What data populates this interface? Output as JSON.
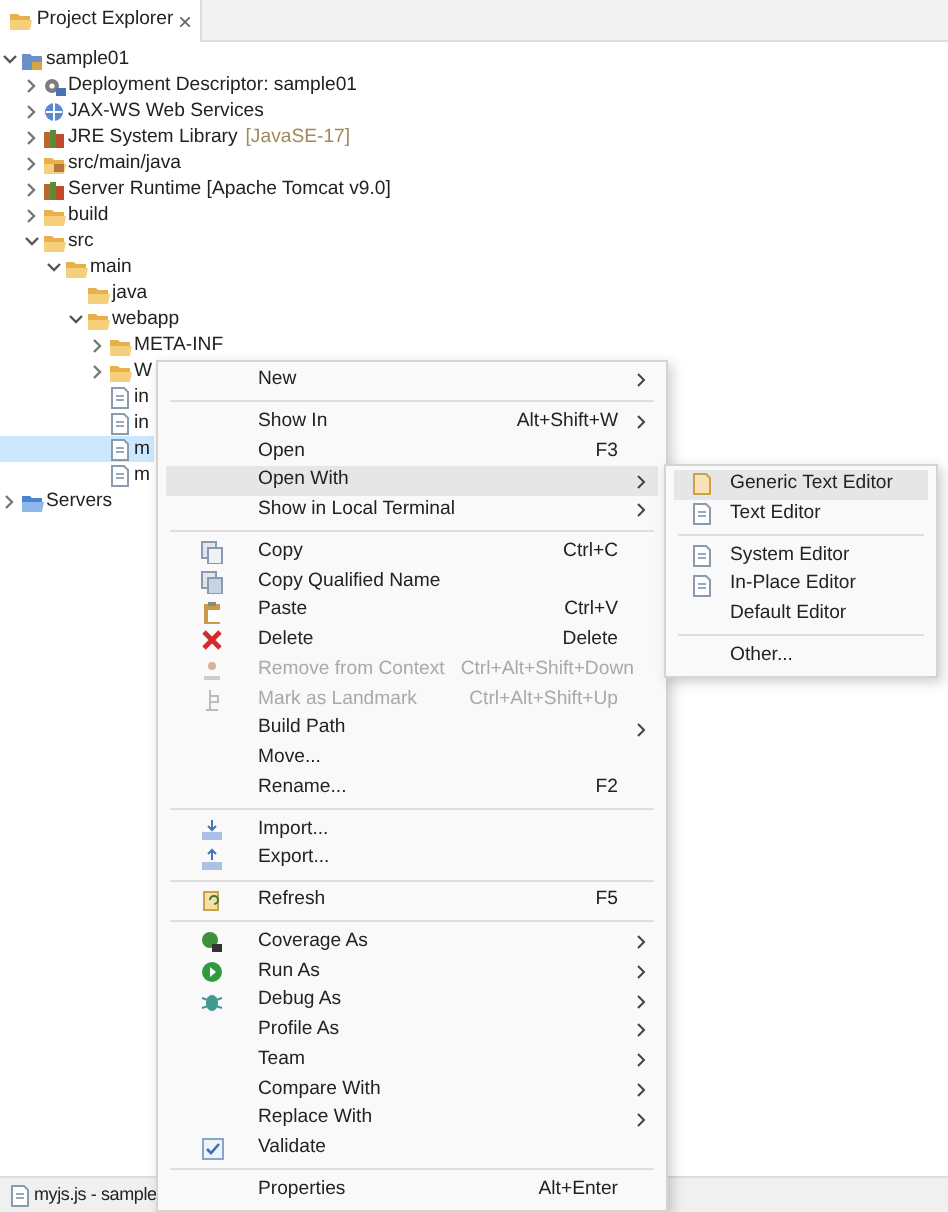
{
  "view_tab": {
    "title": "Project Explorer",
    "close": "×"
  },
  "tree": [
    {
      "label": "sample01",
      "kind": "project",
      "expanded": true,
      "selected": false,
      "children": [
        {
          "label": "Deployment Descriptor: sample01",
          "kind": "deployment",
          "expanded": false,
          "selected": false
        },
        {
          "label": "JAX-WS Web Services",
          "kind": "webservices",
          "expanded": false,
          "selected": false
        },
        {
          "label": "JRE System Library",
          "decoration": "[JavaSE-17]",
          "kind": "library",
          "expanded": false,
          "selected": false
        },
        {
          "label": "src/main/java",
          "kind": "source-folder",
          "expanded": false,
          "selected": false
        },
        {
          "label": "Server Runtime [Apache Tomcat v9.0]",
          "kind": "library",
          "expanded": false,
          "selected": false
        },
        {
          "label": "build",
          "kind": "folder",
          "expanded": false,
          "selected": false
        },
        {
          "label": "src",
          "kind": "folder",
          "expanded": true,
          "selected": false,
          "children": [
            {
              "label": "main",
              "kind": "folder",
              "expanded": true,
              "selected": false,
              "children": [
                {
                  "label": "java",
                  "kind": "folder",
                  "selected": false
                },
                {
                  "label": "webapp",
                  "kind": "folder",
                  "expanded": true,
                  "selected": false,
                  "children": [
                    {
                      "label": "META-INF",
                      "kind": "folder",
                      "expanded": false,
                      "selected": false
                    },
                    {
                      "label": "W",
                      "kind": "folder",
                      "expanded": false,
                      "selected": false
                    },
                    {
                      "label": "in",
                      "kind": "file",
                      "selected": false
                    },
                    {
                      "label": "in",
                      "kind": "file",
                      "selected": false
                    },
                    {
                      "label": "m",
                      "kind": "file",
                      "selected": true
                    },
                    {
                      "label": "m",
                      "kind": "file",
                      "selected": false
                    }
                  ]
                }
              ]
            }
          ]
        }
      ]
    },
    {
      "label": "Servers",
      "kind": "servers",
      "expanded": false,
      "selected": false
    }
  ],
  "status_bar": {
    "text": "myjs.js - sample"
  },
  "context_menu": [
    {
      "kind": "item",
      "label": "New",
      "submenu": true,
      "selected": false,
      "disabled": false,
      "checked": false
    },
    {
      "kind": "separator"
    },
    {
      "kind": "item",
      "label": "Show In",
      "shortcut": "Alt+Shift+W",
      "submenu": true,
      "selected": false,
      "disabled": false,
      "checked": false
    },
    {
      "kind": "item",
      "label": "Open",
      "shortcut": "F3",
      "submenu": false,
      "selected": false,
      "disabled": false,
      "checked": false
    },
    {
      "kind": "item",
      "label": "Open With",
      "submenu": true,
      "selected": true,
      "disabled": false,
      "checked": false
    },
    {
      "kind": "item",
      "label": "Show in Local Terminal",
      "submenu": true,
      "selected": false,
      "disabled": false,
      "checked": false
    },
    {
      "kind": "separator"
    },
    {
      "kind": "item",
      "label": "Copy",
      "shortcut": "Ctrl+C",
      "submenu": false,
      "selected": false,
      "disabled": false,
      "checked": false
    },
    {
      "kind": "item",
      "label": "Copy Qualified Name",
      "submenu": false,
      "selected": false,
      "disabled": false,
      "checked": false
    },
    {
      "kind": "item",
      "label": "Paste",
      "shortcut": "Ctrl+V",
      "submenu": false,
      "selected": false,
      "disabled": false,
      "checked": false
    },
    {
      "kind": "item",
      "label": "Delete",
      "shortcut": "Delete",
      "submenu": false,
      "selected": false,
      "disabled": false,
      "checked": false
    },
    {
      "kind": "item",
      "label": "Remove from Context",
      "shortcut": "Ctrl+Alt+Shift+Down",
      "submenu": false,
      "selected": false,
      "disabled": true,
      "checked": false
    },
    {
      "kind": "item",
      "label": "Mark as Landmark",
      "shortcut": "Ctrl+Alt+Shift+Up",
      "submenu": false,
      "selected": false,
      "disabled": true,
      "checked": false
    },
    {
      "kind": "item",
      "label": "Build Path",
      "submenu": true,
      "selected": false,
      "disabled": false,
      "checked": false
    },
    {
      "kind": "item",
      "label": "Move...",
      "submenu": false,
      "selected": false,
      "disabled": false,
      "checked": false
    },
    {
      "kind": "item",
      "label": "Rename...",
      "shortcut": "F2",
      "submenu": false,
      "selected": false,
      "disabled": false,
      "checked": false
    },
    {
      "kind": "separator"
    },
    {
      "kind": "item",
      "label": "Import...",
      "submenu": false,
      "selected": false,
      "disabled": false,
      "checked": false
    },
    {
      "kind": "item",
      "label": "Export...",
      "submenu": false,
      "selected": false,
      "disabled": false,
      "checked": false
    },
    {
      "kind": "separator"
    },
    {
      "kind": "item",
      "label": "Refresh",
      "shortcut": "F5",
      "submenu": false,
      "selected": false,
      "disabled": false,
      "checked": false
    },
    {
      "kind": "separator"
    },
    {
      "kind": "item",
      "label": "Coverage As",
      "submenu": true,
      "selected": false,
      "disabled": false,
      "checked": false
    },
    {
      "kind": "item",
      "label": "Run As",
      "submenu": true,
      "selected": false,
      "disabled": false,
      "checked": false
    },
    {
      "kind": "item",
      "label": "Debug As",
      "submenu": true,
      "selected": false,
      "disabled": false,
      "checked": false
    },
    {
      "kind": "item",
      "label": "Profile As",
      "submenu": true,
      "selected": false,
      "disabled": false,
      "checked": false
    },
    {
      "kind": "item",
      "label": "Team",
      "submenu": true,
      "selected": false,
      "disabled": false,
      "checked": false
    },
    {
      "kind": "item",
      "label": "Compare With",
      "submenu": true,
      "selected": false,
      "disabled": false,
      "checked": false
    },
    {
      "kind": "item",
      "label": "Replace With",
      "submenu": true,
      "selected": false,
      "disabled": false,
      "checked": false
    },
    {
      "kind": "item",
      "label": "Validate",
      "submenu": false,
      "selected": false,
      "disabled": false,
      "checked": true
    },
    {
      "kind": "separator"
    },
    {
      "kind": "item",
      "label": "Properties",
      "shortcut": "Alt+Enter",
      "submenu": false,
      "selected": false,
      "disabled": false,
      "checked": false
    }
  ],
  "open_with_submenu": [
    {
      "kind": "item",
      "label": "Generic Text Editor",
      "selected": true
    },
    {
      "kind": "item",
      "label": "Text Editor",
      "selected": false
    },
    {
      "kind": "separator"
    },
    {
      "kind": "item",
      "label": "System Editor",
      "selected": false
    },
    {
      "kind": "item",
      "label": "In-Place Editor",
      "selected": false
    },
    {
      "kind": "item",
      "label": "Default Editor",
      "selected": false
    },
    {
      "kind": "separator"
    },
    {
      "kind": "item",
      "label": "Other...",
      "selected": false
    }
  ]
}
